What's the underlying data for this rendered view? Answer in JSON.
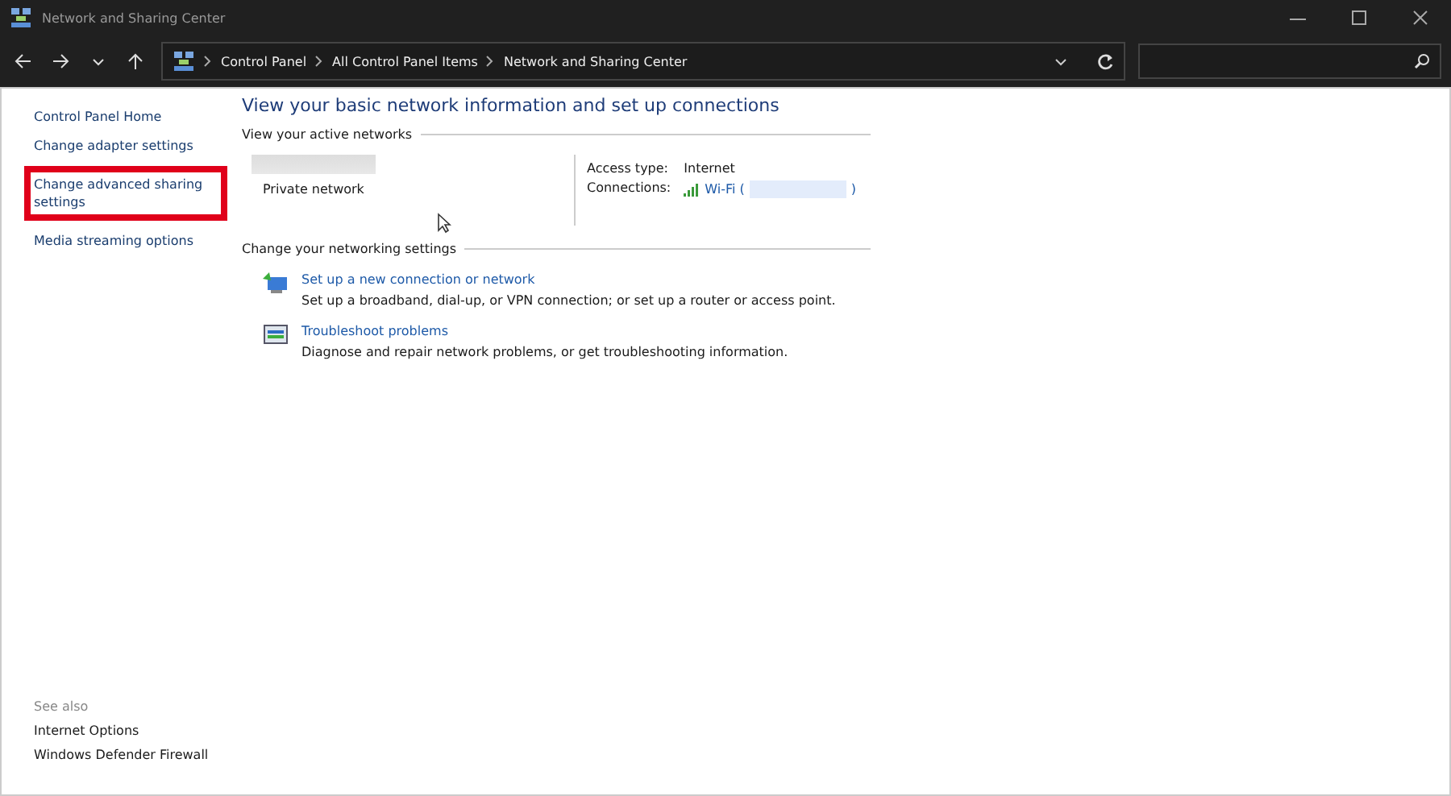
{
  "window": {
    "title": "Network and Sharing Center"
  },
  "breadcrumb": [
    "Control Panel",
    "All Control Panel Items",
    "Network and Sharing Center"
  ],
  "sidebar": {
    "items": [
      {
        "label": "Control Panel Home",
        "highlighted": false
      },
      {
        "label": "Change adapter settings",
        "highlighted": false
      },
      {
        "label": "Change advanced sharing settings",
        "highlighted": true
      },
      {
        "label": "Media streaming options",
        "highlighted": false
      }
    ],
    "see_also_title": "See also",
    "see_also": [
      "Internet Options",
      "Windows Defender Firewall"
    ]
  },
  "main": {
    "heading": "View your basic network information and set up connections",
    "active_networks_title": "View your active networks",
    "network": {
      "category": "Private network",
      "access_type_label": "Access type:",
      "access_type": "Internet",
      "connections_label": "Connections:",
      "connection_prefix": "Wi-Fi (",
      "connection_suffix": ")"
    },
    "settings_title": "Change your networking settings",
    "tasks": [
      {
        "kind": "setup",
        "link": "Set up a new connection or network",
        "description": "Set up a broadband, dial-up, or VPN connection; or set up a router or access point."
      },
      {
        "kind": "troubleshoot",
        "link": "Troubleshoot problems",
        "description": "Diagnose and repair network problems, or get troubleshooting information."
      }
    ]
  }
}
